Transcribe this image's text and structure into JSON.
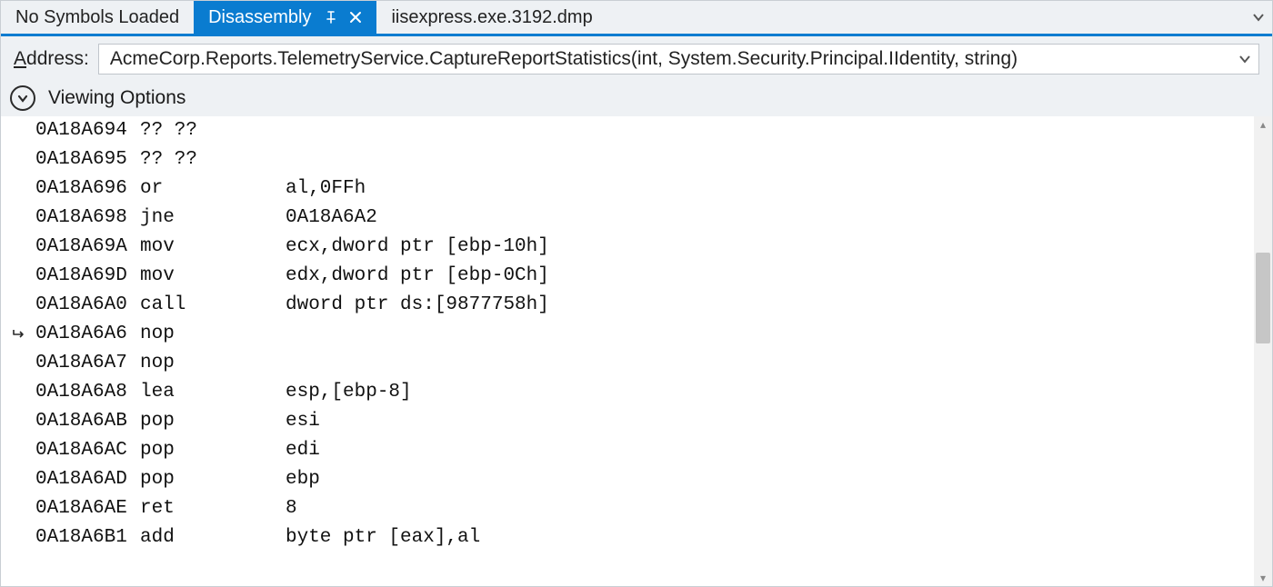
{
  "tabs": {
    "no_symbols": "No Symbols Loaded",
    "disassembly": "Disassembly",
    "dump_file": "iisexpress.exe.3192.dmp"
  },
  "address": {
    "label_pre": "A",
    "label_rest": "ddress:",
    "value": "AcmeCorp.Reports.TelemetryService.CaptureReportStatistics(int, System.Security.Principal.IIdentity, string)"
  },
  "viewing_options_label": "Viewing Options",
  "rows": [
    {
      "pointer": false,
      "addr": "0A18A694",
      "mnem": "?? ??",
      "ops": ""
    },
    {
      "pointer": false,
      "addr": "0A18A695",
      "mnem": "?? ??",
      "ops": ""
    },
    {
      "pointer": false,
      "addr": "0A18A696",
      "mnem": "or",
      "ops": "al,0FFh"
    },
    {
      "pointer": false,
      "addr": "0A18A698",
      "mnem": "jne",
      "ops": "0A18A6A2"
    },
    {
      "pointer": false,
      "addr": "0A18A69A",
      "mnem": "mov",
      "ops": "ecx,dword ptr [ebp-10h]"
    },
    {
      "pointer": false,
      "addr": "0A18A69D",
      "mnem": "mov",
      "ops": "edx,dword ptr [ebp-0Ch]"
    },
    {
      "pointer": false,
      "addr": "0A18A6A0",
      "mnem": "call",
      "ops": "dword ptr ds:[9877758h]"
    },
    {
      "pointer": true,
      "addr": "0A18A6A6",
      "mnem": "nop",
      "ops": ""
    },
    {
      "pointer": false,
      "addr": "0A18A6A7",
      "mnem": "nop",
      "ops": ""
    },
    {
      "pointer": false,
      "addr": "0A18A6A8",
      "mnem": "lea",
      "ops": "esp,[ebp-8]"
    },
    {
      "pointer": false,
      "addr": "0A18A6AB",
      "mnem": "pop",
      "ops": "esi"
    },
    {
      "pointer": false,
      "addr": "0A18A6AC",
      "mnem": "pop",
      "ops": "edi"
    },
    {
      "pointer": false,
      "addr": "0A18A6AD",
      "mnem": "pop",
      "ops": "ebp"
    },
    {
      "pointer": false,
      "addr": "0A18A6AE",
      "mnem": "ret",
      "ops": "8"
    },
    {
      "pointer": false,
      "addr": "0A18A6B1",
      "mnem": "add",
      "ops": "byte ptr [eax],al"
    }
  ]
}
